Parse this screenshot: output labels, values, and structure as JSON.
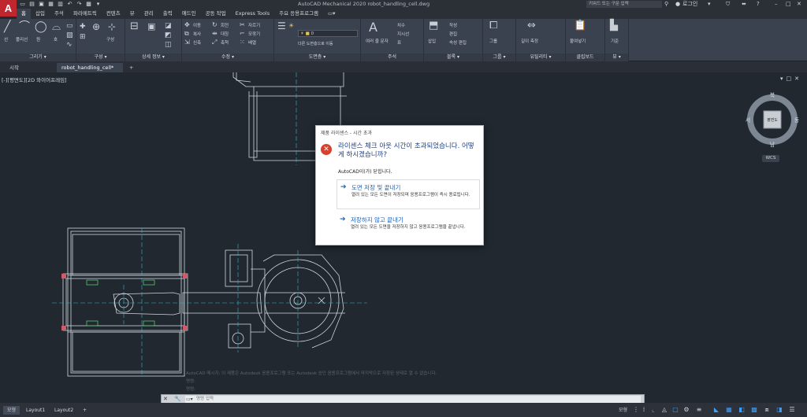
{
  "app": {
    "logo": "A",
    "title": "AutoCAD Mechanical 2020   robot_handling_cell.dwg",
    "search_placeholder": "키워드 또는 구문 입력",
    "user": "로그인"
  },
  "ribbon_tabs": [
    "홈",
    "삽입",
    "주석",
    "파라메트릭",
    "컨텐츠",
    "뷰",
    "관리",
    "출력",
    "애드인",
    "공동 작업",
    "Express Tools",
    "주요 응용프로그램"
  ],
  "ribbon_groups": [
    {
      "label": "그리기 ▾"
    },
    {
      "label": "구성 ▾"
    },
    {
      "label": "상세 정보 ▾"
    },
    {
      "label": "수정 ▾"
    },
    {
      "label": "도면층 ▾"
    },
    {
      "label": "주석"
    },
    {
      "label": "블록 ▾"
    },
    {
      "label": "그룹 ▾"
    },
    {
      "label": "유틸리티 ▾"
    },
    {
      "label": "클립보드"
    },
    {
      "label": "뷰 ▾"
    }
  ],
  "ribbon_items": {
    "line": "선",
    "polyline": "폴리선",
    "circle": "원",
    "arc": "호",
    "construction": "구성",
    "move": "이동",
    "rotate": "회전",
    "trim": "자르기",
    "copy": "복사",
    "mirror": "대칭",
    "fillet": "모깎기",
    "stretch": "신축",
    "scale": "축척",
    "array": "배열",
    "layer_value": "0",
    "layer_props": "도면층 특성",
    "layer_match": "다른 도면층으로 이동",
    "text": "A",
    "text_label": "여러 줄 문자",
    "dim": "치수",
    "leader": "지시선",
    "table": "표",
    "insert": "삽입",
    "create": "작성",
    "edit": "편집",
    "edit_attr": "속성 편집",
    "group": "그룹",
    "measure": "길이 측정",
    "paste": "붙여넣기",
    "base": "기준"
  },
  "doc_tabs": [
    "시작",
    "robot_handling_cell*"
  ],
  "viewport_label": "[-][평면도][2D 와이어프레임]",
  "viewcube": {
    "n": "북",
    "s": "남",
    "e": "동",
    "w": "서",
    "face": "평면도",
    "wcs": "WCS"
  },
  "dialog": {
    "title": "제품 라이센스 - 시간 초과",
    "heading": "라이센스 체크 아웃 시간이 초과되었습니다. 어떻게 하시겠습니까?",
    "message": "AutoCAD이(가) 닫힙니다.",
    "options": [
      {
        "title": "도면 저장 및 끝내기",
        "desc": "열려 있는 모든 도면이 저장되며 응용프로그램이 즉시 종료됩니다."
      },
      {
        "title": "저장하지 않고 끝내기",
        "desc": "열려 있는 모든 도면을 저장하지 않고 응용프로그램을 끝냅니다."
      }
    ]
  },
  "command": {
    "history": [
      "AutoCAD 메시지: 이 제품은 Autodesk 응용프로그램 또는 Autodesk 승인 응용프로그램에서 마지막으로 저장된 상태로 열 수 없습니다.",
      "명령:",
      "명령:"
    ],
    "placeholder": "명령 입력"
  },
  "status_tabs": [
    "모형",
    "Layout1",
    "Layout2",
    "+"
  ],
  "status_right": {
    "model": "모형"
  },
  "colors": {
    "accent": "#1b5fb8",
    "error": "#d7412d",
    "canvas": "#212830"
  }
}
